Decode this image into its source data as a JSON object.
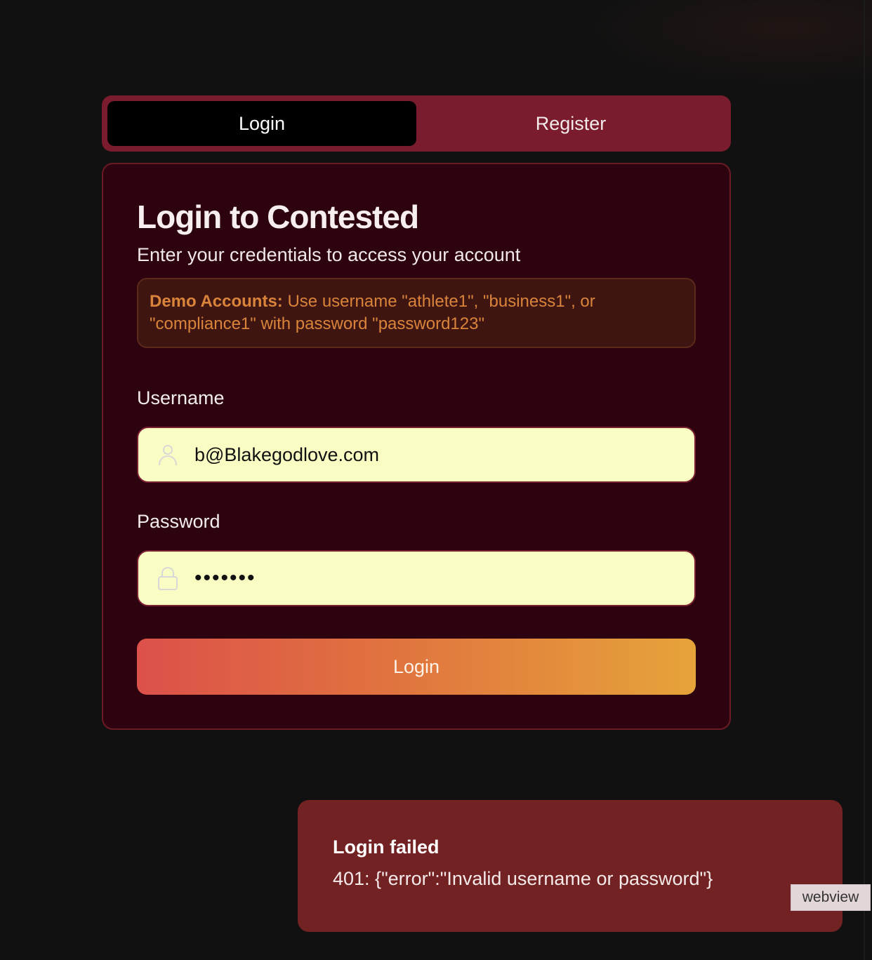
{
  "tabs": [
    {
      "label": "Login",
      "active": true
    },
    {
      "label": "Register",
      "active": false
    }
  ],
  "card": {
    "title": "Login to Contested",
    "subtitle": "Enter your credentials to access your account",
    "demo": {
      "label": "Demo Accounts:",
      "text": " Use username \"athlete1\", \"business1\", or \"compliance1\" with password \"password123\""
    },
    "username": {
      "label": "Username",
      "value": "b@Blakegodlove.com",
      "icon": "user-icon"
    },
    "password": {
      "label": "Password",
      "masked_value": "•••••••",
      "icon": "lock-icon"
    },
    "submit_label": "Login"
  },
  "toast": {
    "title": "Login failed",
    "message": "401: {\"error\":\"Invalid username or password\"}"
  },
  "badge": {
    "label": "webview"
  },
  "colors": {
    "background": "#111111",
    "tab_bar": "#7a1c2e",
    "card_background": "#2c030e",
    "input_background": "#fafdc3",
    "demo_text": "#d9843a",
    "button_gradient_start": "#dc514a",
    "button_gradient_end": "#e6a33a",
    "toast_background": "#722222"
  }
}
